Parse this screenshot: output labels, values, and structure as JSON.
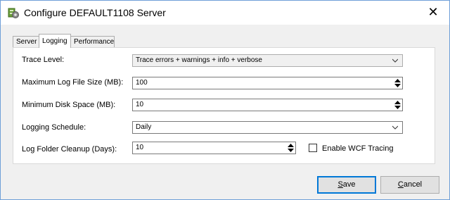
{
  "window": {
    "title": "Configure DEFAULT1108 Server"
  },
  "icons": {
    "app": "server-config-icon",
    "close": "close-icon",
    "dropdown": "chevron-down-icon",
    "spinner": "spinner-arrows-icon"
  },
  "tabs": [
    {
      "label": "Server",
      "active": false
    },
    {
      "label": "Logging",
      "active": true
    },
    {
      "label": "Performance",
      "active": false
    }
  ],
  "fields": {
    "trace_level": {
      "label": "Trace Level:",
      "value": "Trace errors + warnings + info + verbose"
    },
    "max_log_size": {
      "label": "Maximum Log File Size (MB):",
      "value": "100"
    },
    "min_disk_space": {
      "label": "Minimum Disk Space (MB):",
      "value": "10"
    },
    "logging_schedule": {
      "label": "Logging Schedule:",
      "value": "Daily"
    },
    "log_cleanup": {
      "label": "Log Folder Cleanup (Days):",
      "value": "10"
    },
    "wcf_tracing": {
      "label": "Enable WCF Tracing",
      "checked": false
    }
  },
  "buttons": {
    "save": {
      "label_first": "S",
      "label_rest": "ave"
    },
    "cancel": {
      "label_first": "C",
      "label_rest": "ancel"
    }
  }
}
